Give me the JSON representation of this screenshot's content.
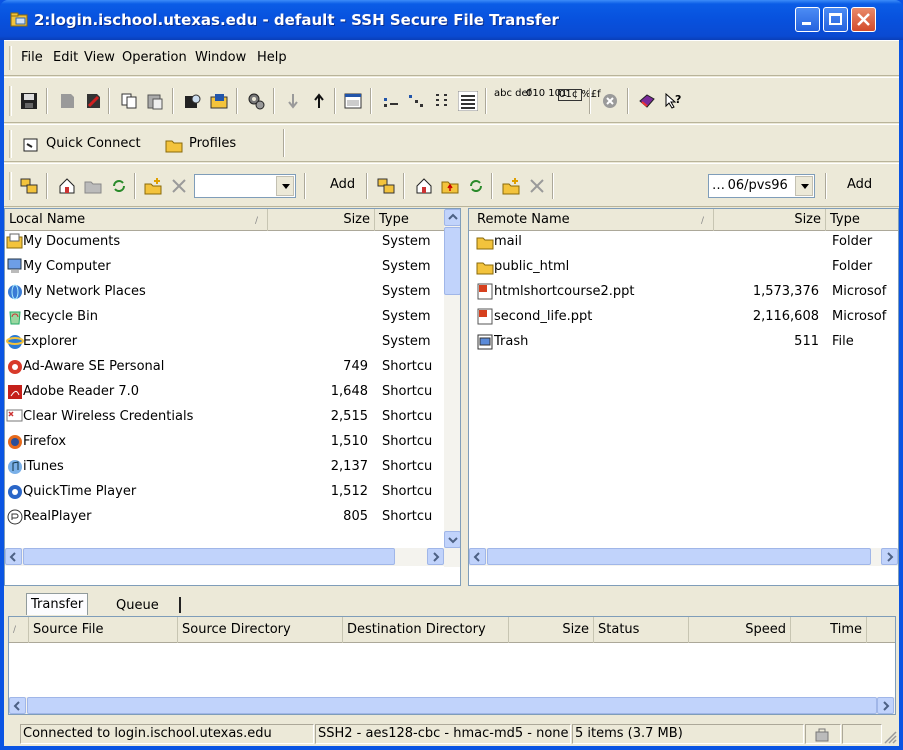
{
  "window": {
    "title": "2:login.ischool.utexas.edu - default - SSH Secure File Transfer"
  },
  "menu": [
    "File",
    "Edit",
    "View",
    "Operation",
    "Window",
    "Help"
  ],
  "toolbar": {
    "text_icon_1": "abc def",
    "text_icon_2": "010 101",
    "text_icon_3": "01¢ %£f"
  },
  "quickbar": {
    "quick_connect": "Quick Connect",
    "profiles": "Profiles"
  },
  "pathbar": {
    "local_path": "",
    "local_add": "Add",
    "remote_path": "… 06/pvs96",
    "remote_add": "Add"
  },
  "local": {
    "headers": [
      "Local Name",
      "Size",
      "Type"
    ],
    "rows": [
      {
        "name": "My Documents",
        "size": "",
        "type": "System",
        "icon": "my-documents-icon"
      },
      {
        "name": "My Computer",
        "size": "",
        "type": "System",
        "icon": "my-computer-icon"
      },
      {
        "name": "My Network Places",
        "size": "",
        "type": "System",
        "icon": "network-places-icon"
      },
      {
        "name": "Recycle Bin",
        "size": "",
        "type": "System",
        "icon": "recycle-bin-icon"
      },
      {
        "name": "Explorer",
        "size": "",
        "type": "System",
        "icon": "internet-explorer-icon"
      },
      {
        "name": "Ad-Aware SE Personal",
        "size": "749",
        "type": "Shortcu",
        "icon": "ad-aware-icon"
      },
      {
        "name": "Adobe Reader 7.0",
        "size": "1,648",
        "type": "Shortcu",
        "icon": "adobe-reader-icon"
      },
      {
        "name": "Clear Wireless Credentials",
        "size": "2,515",
        "type": "Shortcu",
        "icon": "credentials-icon"
      },
      {
        "name": "Firefox",
        "size": "1,510",
        "type": "Shortcu",
        "icon": "firefox-icon"
      },
      {
        "name": "iTunes",
        "size": "2,137",
        "type": "Shortcu",
        "icon": "itunes-icon"
      },
      {
        "name": "QuickTime Player",
        "size": "1,512",
        "type": "Shortcu",
        "icon": "quicktime-icon"
      },
      {
        "name": "RealPlayer",
        "size": "805",
        "type": "Shortcu",
        "icon": "realplayer-icon"
      }
    ]
  },
  "remote": {
    "headers": [
      "Remote Name",
      "Size",
      "Type"
    ],
    "rows": [
      {
        "name": "mail",
        "size": "",
        "type": "Folder",
        "icon": "folder-icon"
      },
      {
        "name": "public_html",
        "size": "",
        "type": "Folder",
        "icon": "folder-icon"
      },
      {
        "name": "htmlshortcourse2.ppt",
        "size": "1,573,376",
        "type": "Microsof",
        "icon": "powerpoint-file-icon"
      },
      {
        "name": "second_life.ppt",
        "size": "2,116,608",
        "type": "Microsof",
        "icon": "powerpoint-file-icon"
      },
      {
        "name": "Trash",
        "size": "511",
        "type": "File",
        "icon": "file-icon"
      }
    ]
  },
  "transfer": {
    "tabs": [
      "Transfer",
      "Queue"
    ],
    "headers": [
      "Source File",
      "Source Directory",
      "Destination Directory",
      "Size",
      "Status",
      "Speed",
      "Time"
    ]
  },
  "statusbar": {
    "connection": "Connected to login.ischool.utexas.edu",
    "cipher": "SSH2 - aes128-cbc - hmac-md5 - none",
    "items": "5 items (3.7 MB)"
  }
}
